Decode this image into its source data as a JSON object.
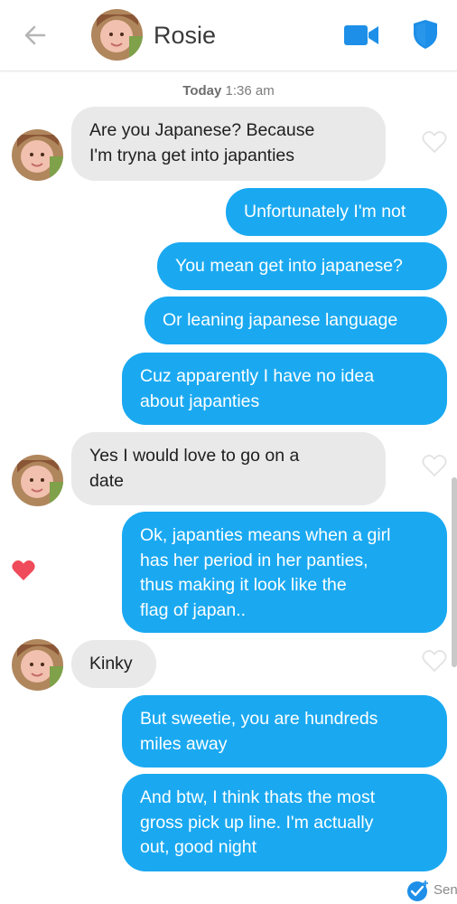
{
  "header": {
    "contact_name": "Rosie"
  },
  "timestamp": {
    "day": "Today",
    "time": "1:36 am"
  },
  "messages": [
    {
      "dir": "in",
      "text": "Are you Japanese? Because\nI'm tryna get into japanties",
      "liked": false
    },
    {
      "dir": "out",
      "text": "Unfortunately I'm not"
    },
    {
      "dir": "out",
      "text": "You mean get into japanese?"
    },
    {
      "dir": "out",
      "text": "Or leaning japanese language"
    },
    {
      "dir": "out",
      "text": "Cuz apparently I have no idea\nabout japanties"
    },
    {
      "dir": "in",
      "text": "Yes I would love to go on a\ndate",
      "liked": false
    },
    {
      "dir": "out",
      "text": "Ok, japanties means when a girl\nhas her period in her panties,\nthus making it look like the\nflag of japan..",
      "liked": true
    },
    {
      "dir": "in",
      "text": "Kinky",
      "liked": false
    },
    {
      "dir": "out",
      "text": "But sweetie, you are hundreds\nmiles away"
    },
    {
      "dir": "out",
      "text": "And btw, I think thats the most\ngross pick up line. I'm actually\nout, good night"
    }
  ],
  "status": {
    "label": "Sent"
  },
  "colors": {
    "outgoing_bubble": "#1aa9f1",
    "incoming_bubble": "#e9e9e9",
    "accent_blue": "#1d8fe8",
    "like_red": "#ef4b5a"
  }
}
